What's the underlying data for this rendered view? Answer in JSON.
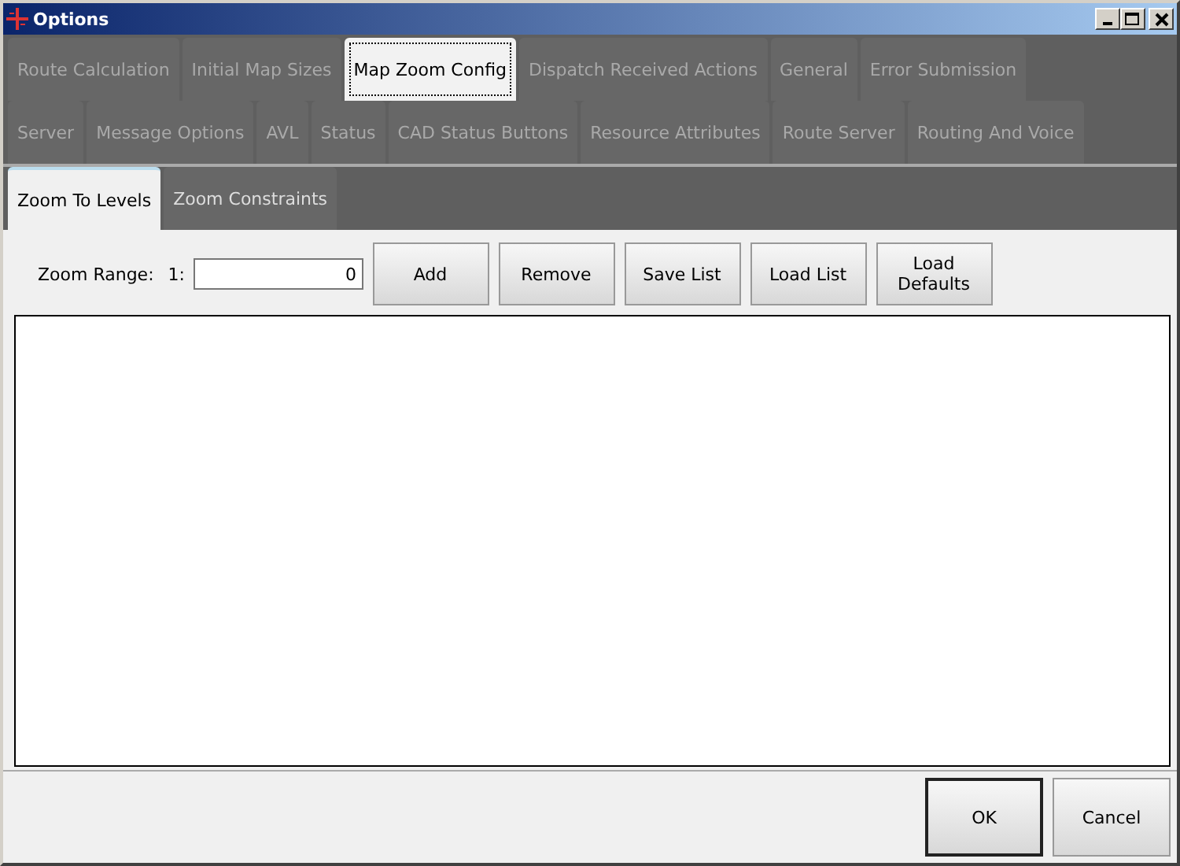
{
  "window": {
    "title": "Options"
  },
  "tab_rows": [
    [
      {
        "label": "Route Calculation",
        "selected": false
      },
      {
        "label": "Initial Map Sizes",
        "selected": false
      },
      {
        "label": "Map Zoom Config",
        "selected": true
      },
      {
        "label": "Dispatch Received Actions",
        "selected": false
      },
      {
        "label": "General",
        "selected": false
      },
      {
        "label": "Error Submission",
        "selected": false
      }
    ],
    [
      {
        "label": "Server",
        "selected": false
      },
      {
        "label": "Message Options",
        "selected": false
      },
      {
        "label": "AVL",
        "selected": false
      },
      {
        "label": "Status",
        "selected": false
      },
      {
        "label": "CAD Status Buttons",
        "selected": false
      },
      {
        "label": "Resource Attributes",
        "selected": false
      },
      {
        "label": "Route Server",
        "selected": false
      },
      {
        "label": "Routing And Voice",
        "selected": false
      }
    ]
  ],
  "subtabs": [
    {
      "label": "Zoom To Levels",
      "selected": true
    },
    {
      "label": "Zoom Constraints",
      "selected": false
    }
  ],
  "zoom_range": {
    "label": "Zoom Range:",
    "prefix": "1:",
    "value": "0"
  },
  "buttons": [
    "Add",
    "Remove",
    "Save List",
    "Load List",
    "Load Defaults"
  ],
  "footer_buttons": [
    {
      "label": "OK",
      "default": true
    },
    {
      "label": "Cancel",
      "default": false
    }
  ]
}
